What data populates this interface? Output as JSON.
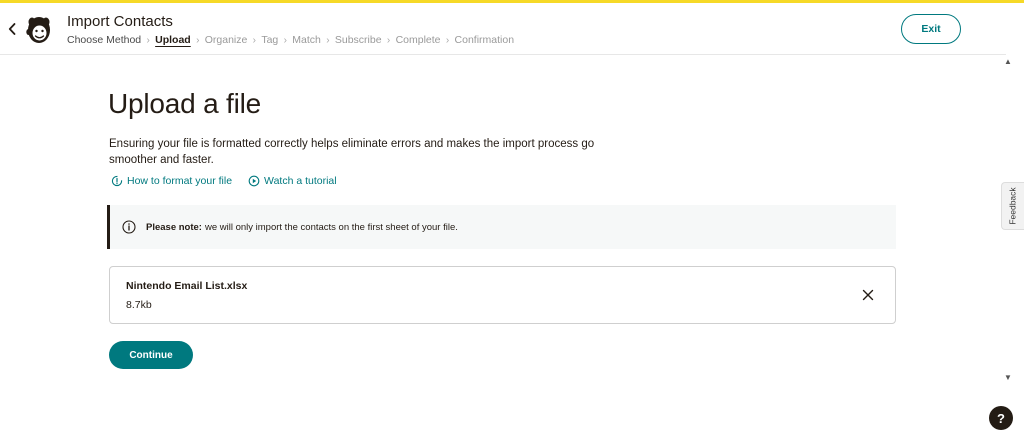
{
  "header": {
    "title": "Import Contacts",
    "steps": [
      {
        "label": "Choose Method",
        "state": "done"
      },
      {
        "label": "Upload",
        "state": "current"
      },
      {
        "label": "Organize",
        "state": "todo"
      },
      {
        "label": "Tag",
        "state": "todo"
      },
      {
        "label": "Match",
        "state": "todo"
      },
      {
        "label": "Subscribe",
        "state": "todo"
      },
      {
        "label": "Complete",
        "state": "todo"
      },
      {
        "label": "Confirmation",
        "state": "todo"
      }
    ],
    "exit_label": "Exit",
    "back_icon": "chevron-left-icon",
    "logo_icon": "mailchimp-freddie-logo"
  },
  "main": {
    "title": "Upload a file",
    "description": "Ensuring your file is formatted correctly helps eliminate errors and makes the import process go smoother and faster.",
    "links": {
      "format": "How to format your file",
      "tutorial": "Watch a tutorial"
    },
    "note": {
      "bold": "Please note:",
      "text": "we will only import the contacts on the first sheet of your file."
    },
    "file": {
      "name": "Nintendo Email List.xlsx",
      "size": "8.7kb"
    },
    "continue_label": "Continue"
  },
  "side": {
    "feedback_label": "Feedback",
    "help_label": "?"
  },
  "colors": {
    "accent": "#00797f",
    "top_bar": "#f6d928",
    "text": "#241c15"
  }
}
